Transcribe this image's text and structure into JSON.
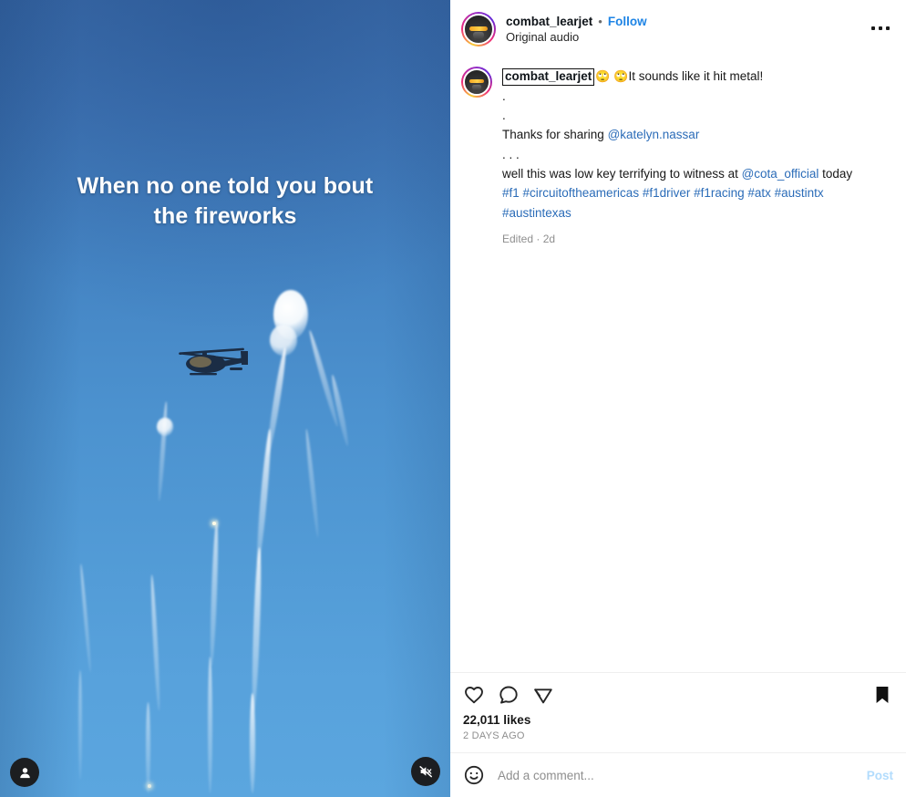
{
  "header": {
    "username": "combat_learjet",
    "separator": "•",
    "follow_label": "Follow",
    "audio_label": "Original audio",
    "more_icon": "more-options-icon",
    "avatar_icon": "profile-avatar"
  },
  "caption": {
    "username": "combat_learjet",
    "emoji1": "🙄",
    "emoji2": "🙄",
    "line1_text": "It sounds like it hit metal!",
    "line2": ".",
    "line3": ".",
    "line4_prefix": "Thanks for sharing ",
    "line4_mention": "@katelyn.nassar",
    "line5": ".  .  .",
    "line6_prefix": "well this was low key terrifying to witness at ",
    "line6_mention": "@cota_official",
    "line6_suffix": " today",
    "hashtags": "#f1 #circuitoftheamericas #f1driver #f1racing #atx #austintx #austintexas",
    "meta": "Edited · 2d"
  },
  "video": {
    "overlay_line1": "When no one told you bout",
    "overlay_line2": "the fireworks",
    "profile_button_icon": "person-icon",
    "mute_button_icon": "speaker-muted-icon",
    "sky_color_top": "#3a6aa8",
    "sky_color_bottom": "#5ba6df"
  },
  "actions": {
    "like_icon": "heart-icon",
    "comment_icon": "comment-bubble-icon",
    "share_icon": "share-paper-plane-icon",
    "save_icon": "bookmark-filled-icon",
    "likes_count": "22,011 likes",
    "timestamp": "2 DAYS AGO"
  },
  "comment_box": {
    "emoji_icon": "emoji-smiley-icon",
    "placeholder": "Add a comment...",
    "post_label": "Post"
  },
  "colors": {
    "link_blue": "#1e84e5",
    "mention_blue": "#2b6cb8",
    "post_disabled": "#b2dcfd",
    "muted_gray": "#8e8e8e"
  }
}
